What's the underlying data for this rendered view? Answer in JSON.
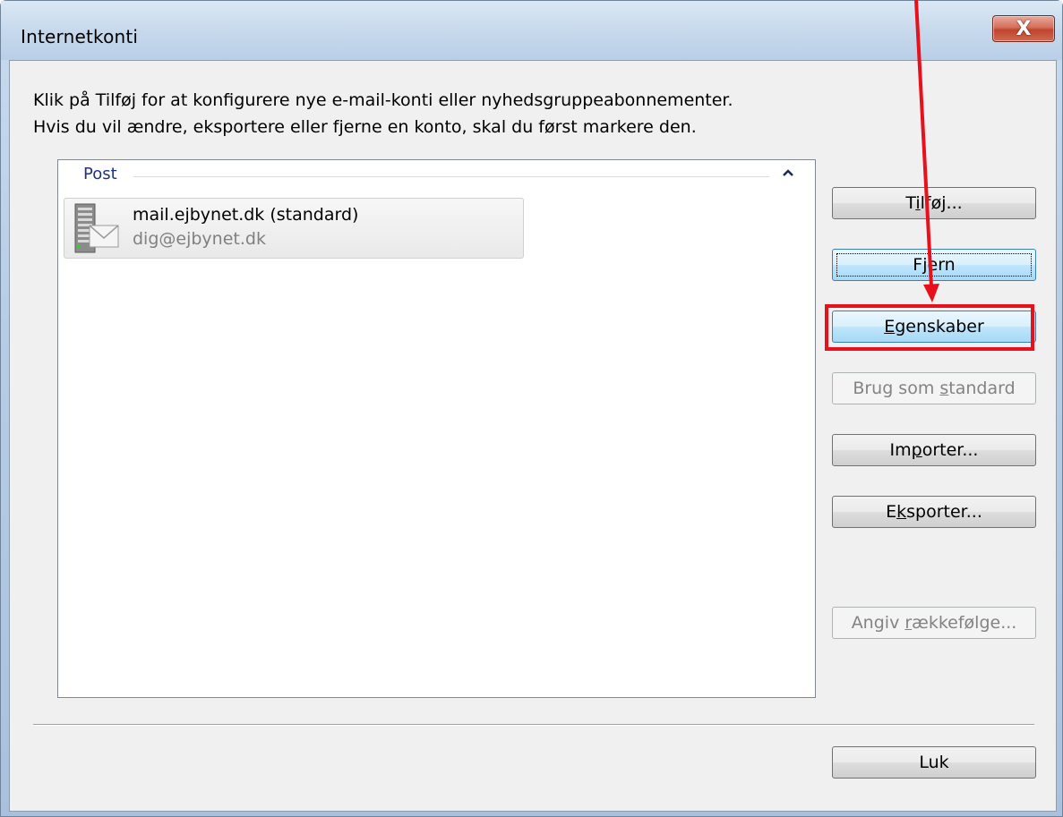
{
  "window": {
    "title": "Internetkonti",
    "close_label": "X"
  },
  "intro": {
    "line1": "Klik på Tilføj for at konfigurere nye e-mail-konti eller nyhedsgruppeabonnementer.",
    "line2": "Hvis du vil ændre, eksportere eller fjerne en konto, skal du først markere den."
  },
  "list": {
    "group_label": "Post",
    "collapse_glyph": "^",
    "accounts": [
      {
        "name": "mail.ejbynet.dk (standard)",
        "email": "dig@ejbynet.dk",
        "icon": "mail-server-icon"
      }
    ]
  },
  "buttons": {
    "add": {
      "pre": "T",
      "key": "i",
      "post": "lføj..."
    },
    "remove": {
      "pre": "F",
      "key": "j",
      "post": "ern"
    },
    "properties": {
      "pre": "",
      "key": "E",
      "post": "genskaber"
    },
    "set_default": {
      "pre": "Brug som ",
      "key": "s",
      "post": "tandard"
    },
    "import": {
      "pre": "Im",
      "key": "p",
      "post": "orter..."
    },
    "export": {
      "pre": "E",
      "key": "k",
      "post": "sporter..."
    },
    "set_order": {
      "pre": "Angiv ",
      "key": "r",
      "post": "ækkefølge..."
    },
    "close": "Luk"
  },
  "annotation": {
    "highlight_color": "#e8101a"
  }
}
